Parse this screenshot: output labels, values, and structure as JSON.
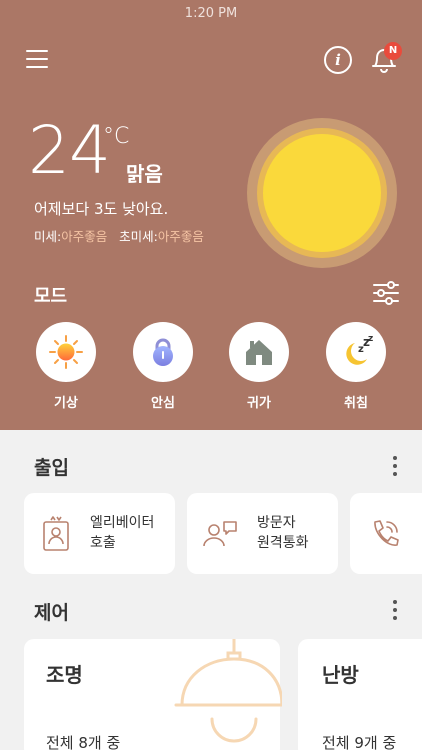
{
  "status_bar": {
    "time": "1:20 PM"
  },
  "header": {
    "notification_badge": "N"
  },
  "weather": {
    "temperature": "24",
    "unit": "°C",
    "condition": "맑음",
    "compare": "어제보다 3도 낮아요.",
    "fine_dust_label": "미세:",
    "fine_dust_value": "아주좋음",
    "ultrafine_dust_label": "초미세:",
    "ultrafine_dust_value": "아주좋음"
  },
  "mode": {
    "title": "모드",
    "items": [
      {
        "label": "기상",
        "icon": "sunrise-icon"
      },
      {
        "label": "안심",
        "icon": "lock-icon"
      },
      {
        "label": "귀가",
        "icon": "home-icon"
      },
      {
        "label": "취침",
        "icon": "moon-sleep-icon"
      }
    ]
  },
  "access": {
    "title": "출입",
    "items": [
      {
        "label_line1": "엘리베이터",
        "label_line2": "호출",
        "icon": "elevator-call-icon"
      },
      {
        "label_line1": "방문자",
        "label_line2": "원격통화",
        "icon": "visitor-call-icon"
      },
      {
        "icon": "phone-call-icon"
      }
    ]
  },
  "control": {
    "title": "제어",
    "items": [
      {
        "title": "조명",
        "count": "전체 8개 중",
        "icon": "lamp-icon"
      },
      {
        "title": "난방",
        "count": "전체 9개 중"
      }
    ]
  },
  "colors": {
    "hero_background": "#ab7766",
    "sun": "#fad93b",
    "dust_value": "#f5c4a4",
    "badge": "#e94b3c",
    "lamp": "#f6d7b3"
  }
}
